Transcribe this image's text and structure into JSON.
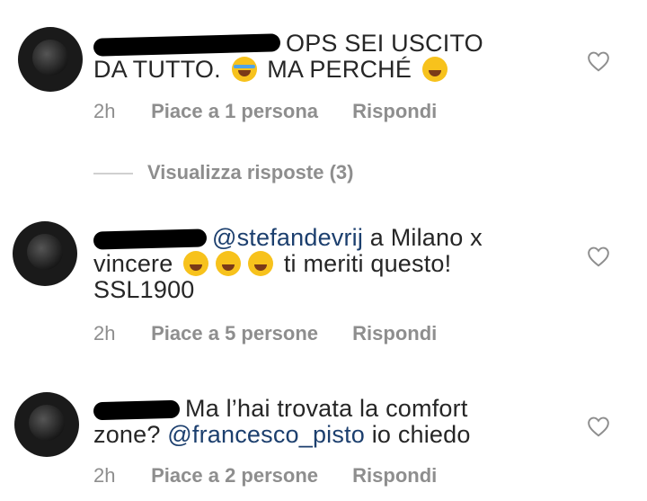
{
  "comments": [
    {
      "text_before": "",
      "text_main": "OPS SEI USCITO DA TUTTO.",
      "text_after": "MA PERCHÉ",
      "mention": "",
      "time": "2h",
      "likes": "Piace a 1 persona",
      "reply": "Rispondi"
    },
    {
      "text_before": "",
      "mention": "@stefandevrij",
      "text_main": "a Milano x vincere",
      "text_after": "ti meriti questo! SSL1900",
      "time": "2h",
      "likes": "Piace a 5 persone",
      "reply": "Rispondi"
    },
    {
      "text_main": "Ma l’hai trovata la comfort zone?",
      "mention": "@francesco_pisto",
      "text_after": "io chiedo",
      "time": "2h",
      "likes": "Piace a 2 persone",
      "reply": "Rispondi"
    }
  ],
  "view_replies": "Visualizza risposte (3)",
  "icons": {
    "like": "heart-icon",
    "emoji_1": "loudly-crying-face",
    "emoji_2": "rolling-on-floor-laughing",
    "emoji_3": "face-with-tears-of-joy"
  },
  "colors": {
    "text": "#262626",
    "muted": "#8e8e8e",
    "mention": "#1c3f6e"
  }
}
